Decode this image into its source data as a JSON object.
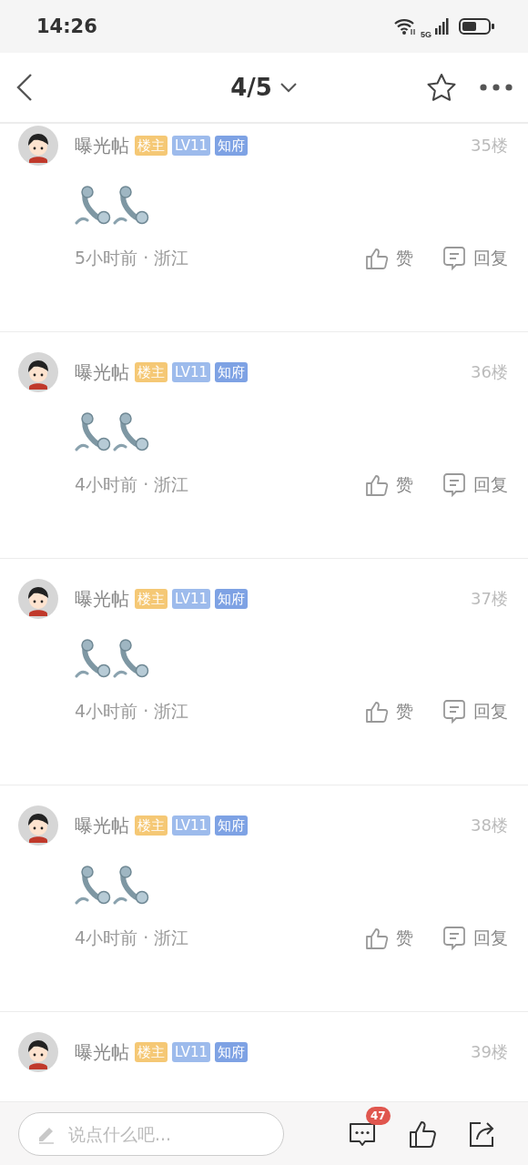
{
  "status_bar": {
    "time": "14:26",
    "network": "5G"
  },
  "nav": {
    "title": "4/5"
  },
  "posts": [
    {
      "author": "曝光帖",
      "badges": [
        {
          "label": "楼主",
          "color": "#f5c875"
        },
        {
          "label": "LV11",
          "color": "#9dbbec"
        },
        {
          "label": "知府",
          "color": "#7ea2e4"
        }
      ],
      "floor": "35楼",
      "stickers": [
        {
          "kind": "phone"
        },
        {
          "kind": "phone"
        }
      ],
      "meta": "5小时前 · 浙江",
      "like_label": "赞",
      "reply_label": "回复"
    },
    {
      "author": "曝光帖",
      "badges": [
        {
          "label": "楼主",
          "color": "#f5c875"
        },
        {
          "label": "LV11",
          "color": "#9dbbec"
        },
        {
          "label": "知府",
          "color": "#7ea2e4"
        }
      ],
      "floor": "36楼",
      "stickers": [
        {
          "kind": "phone"
        },
        {
          "kind": "phone"
        }
      ],
      "meta": "4小时前 · 浙江",
      "like_label": "赞",
      "reply_label": "回复"
    },
    {
      "author": "曝光帖",
      "badges": [
        {
          "label": "楼主",
          "color": "#f5c875"
        },
        {
          "label": "LV11",
          "color": "#9dbbec"
        },
        {
          "label": "知府",
          "color": "#7ea2e4"
        }
      ],
      "floor": "37楼",
      "stickers": [
        {
          "kind": "phone"
        },
        {
          "kind": "phone"
        }
      ],
      "meta": "4小时前 · 浙江",
      "like_label": "赞",
      "reply_label": "回复"
    },
    {
      "author": "曝光帖",
      "badges": [
        {
          "label": "楼主",
          "color": "#f5c875"
        },
        {
          "label": "LV11",
          "color": "#9dbbec"
        },
        {
          "label": "知府",
          "color": "#7ea2e4"
        }
      ],
      "floor": "38楼",
      "stickers": [
        {
          "kind": "phone"
        },
        {
          "kind": "phone"
        }
      ],
      "meta": "4小时前 · 浙江",
      "like_label": "赞",
      "reply_label": "回复"
    },
    {
      "author": "曝光帖",
      "badges": [
        {
          "label": "楼主",
          "color": "#f5c875"
        },
        {
          "label": "LV11",
          "color": "#9dbbec"
        },
        {
          "label": "知府",
          "color": "#7ea2e4"
        }
      ],
      "floor": "39楼"
    }
  ],
  "composer": {
    "placeholder": "说点什么吧...",
    "comment_count": "47"
  }
}
